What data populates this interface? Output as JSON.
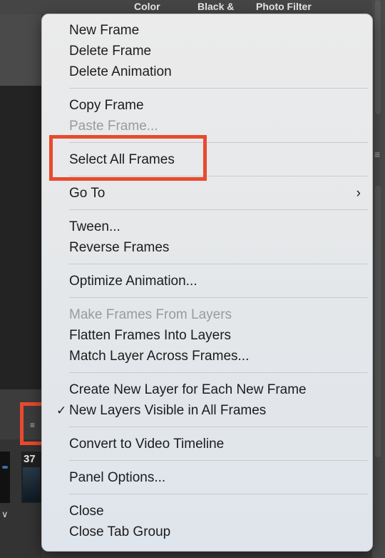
{
  "background": {
    "top_labels": [
      "Color",
      "Black &",
      "Photo Filter"
    ],
    "frame_number": "37"
  },
  "menu": {
    "groups": [
      [
        {
          "label": "New Frame",
          "enabled": true
        },
        {
          "label": "Delete Frame",
          "enabled": true
        },
        {
          "label": "Delete Animation",
          "enabled": true
        }
      ],
      [
        {
          "label": "Copy Frame",
          "enabled": true
        },
        {
          "label": "Paste Frame...",
          "enabled": false
        }
      ],
      [
        {
          "label": "Select All Frames",
          "enabled": true,
          "highlighted": true
        }
      ],
      [
        {
          "label": "Go To",
          "enabled": true,
          "submenu": true
        }
      ],
      [
        {
          "label": "Tween...",
          "enabled": true
        },
        {
          "label": "Reverse Frames",
          "enabled": true
        }
      ],
      [
        {
          "label": "Optimize Animation...",
          "enabled": true
        }
      ],
      [
        {
          "label": "Make Frames From Layers",
          "enabled": false
        },
        {
          "label": "Flatten Frames Into Layers",
          "enabled": true
        },
        {
          "label": "Match Layer Across Frames...",
          "enabled": true
        }
      ],
      [
        {
          "label": "Create New Layer for Each New Frame",
          "enabled": true
        },
        {
          "label": "New Layers Visible in All Frames",
          "enabled": true,
          "checked": true
        }
      ],
      [
        {
          "label": "Convert to Video Timeline",
          "enabled": true
        }
      ],
      [
        {
          "label": "Panel Options...",
          "enabled": true
        }
      ],
      [
        {
          "label": "Close",
          "enabled": true
        },
        {
          "label": "Close Tab Group",
          "enabled": true
        }
      ]
    ]
  },
  "colors": {
    "annotation": "#e84a2f"
  }
}
